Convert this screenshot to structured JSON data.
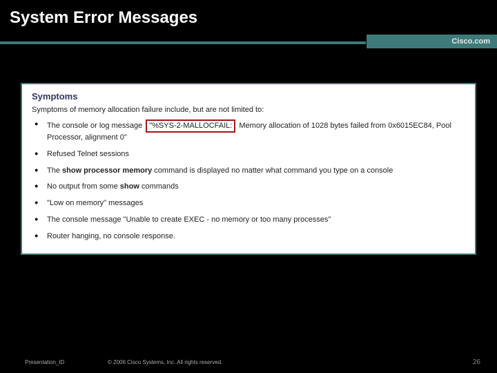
{
  "slide": {
    "title": "System Error Messages",
    "brand": "Cisco.com"
  },
  "content": {
    "section_title": "Symptoms",
    "intro": "Symptoms of memory allocation failure include, but are not limited to:",
    "items": {
      "i0_pre": "The console or log message ",
      "i0_hl": "\"%SYS-2-MALLOCFAIL:",
      "i0_post": " Memory allocation of 1028 bytes failed from 0x6015EC84, Pool Processor, alignment 0\"",
      "i1": "Refused Telnet sessions",
      "i2_pre": "The ",
      "i2_cmd": "show processor memory",
      "i2_post": " command is displayed no matter what command you type on a console",
      "i3_pre": "No output from some ",
      "i3_cmd": "show",
      "i3_post": " commands",
      "i4": "\"Low on memory\" messages",
      "i5": "The console message \"Unable to create EXEC - no memory or too many processes\"",
      "i6": "Router hanging, no console response."
    }
  },
  "footer": {
    "presentation_id": "Presentation_ID",
    "copyright": "© 2006 Cisco Systems, Inc. All rights reserved.",
    "page": "26"
  }
}
